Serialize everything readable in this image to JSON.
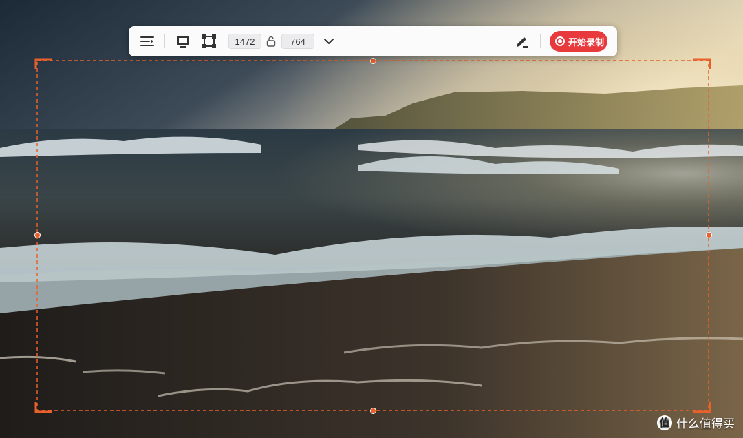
{
  "toolbar": {
    "width_value": "1472",
    "height_value": "764",
    "record_label": "开始录制",
    "icons": {
      "menu": "menu-lines-icon",
      "screen": "screen-capture-icon",
      "region": "region-select-icon",
      "lock": "aspect-lock-icon",
      "dropdown": "chevron-down-icon",
      "annotate": "pen-edit-icon",
      "record": "record-icon"
    }
  },
  "watermark": {
    "logo_glyph": "值",
    "text": "什么值得买"
  },
  "colors": {
    "accent": "#e8612c",
    "record": "#e8393d",
    "toolbar_bg": "#fbfbfc"
  }
}
